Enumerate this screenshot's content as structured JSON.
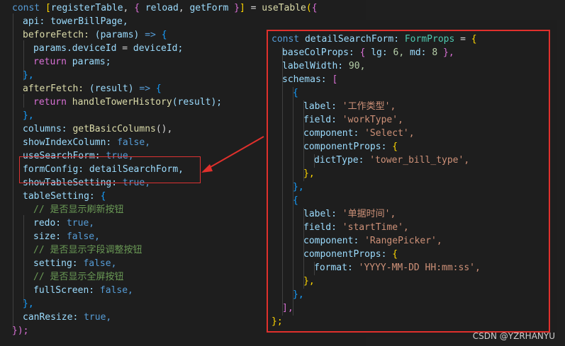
{
  "left_code": {
    "l1": {
      "a": "const",
      "b": "[",
      "c": "registerTable",
      ",": ",",
      "d": "{",
      "e": "reload",
      ",2": ",",
      "f": "getForm",
      "g": "}",
      "h": "]",
      "i": "=",
      "j": "useTable",
      "k": "(",
      "l": "{"
    },
    "l2": {
      "a": "api:",
      "b": "towerBillPage,"
    },
    "l3": {
      "a": "beforeFetch:",
      "b": "(params)",
      "c": "=>",
      "d": "{"
    },
    "l4": {
      "a": "params.deviceId",
      "b": "=",
      "c": "deviceId;"
    },
    "l5": {
      "a": "return",
      "b": "params;"
    },
    "l6": {
      "a": "},"
    },
    "l7": {
      "a": "afterFetch:",
      "b": "(result)",
      "c": "=>",
      "d": "{"
    },
    "l8": {
      "a": "return",
      "b": "handleTowerHistory",
      "c": "(result);"
    },
    "l9": {
      "a": "},"
    },
    "l10": {
      "a": "columns:",
      "b": "getBasicColumns",
      "c": "(),"
    },
    "l11": {
      "a": "showIndexColumn:",
      "b": "false,"
    },
    "l12": {
      "a": "useSearchForm:",
      "b": "true,"
    },
    "l13": {
      "a": "formConfig:",
      "b": "detailSearchForm,"
    },
    "l14": {
      "a": "showTableSetting:",
      "b": "true,"
    },
    "l15": {
      "a": "tableSetting:",
      "b": "{"
    },
    "l16": {
      "a": "// 是否显示刷新按钮"
    },
    "l17": {
      "a": "redo:",
      "b": "true,"
    },
    "l18": {
      "a": "size:",
      "b": "false,"
    },
    "l19": {
      "a": "// 是否显示字段调整按钮"
    },
    "l20": {
      "a": "setting:",
      "b": "false,"
    },
    "l21": {
      "a": "// 是否显示全屏按钮"
    },
    "l22": {
      "a": "fullScreen:",
      "b": "false,"
    },
    "l23": {
      "a": "},"
    },
    "l24": {
      "a": "canResize:",
      "b": "true,"
    },
    "l25": {
      "a": "});"
    }
  },
  "right_code": {
    "r1": {
      "a": "const",
      "b": "detailSearchForm:",
      "c": "FormProps",
      "d": "=",
      "e": "{"
    },
    "r2": {
      "a": "baseColProps:",
      "b": "{",
      "c": "lg:",
      "d": "6,",
      "e": "md:",
      "f": "8",
      "g": "},"
    },
    "r3": {
      "a": "labelWidth:",
      "b": "90,"
    },
    "r4": {
      "a": "schemas:",
      "b": "["
    },
    "r5": {
      "a": "{"
    },
    "r6": {
      "a": "label:",
      "b": "'工作类型',"
    },
    "r7": {
      "a": "field:",
      "b": "'workType',"
    },
    "r8": {
      "a": "component:",
      "b": "'Select',"
    },
    "r9": {
      "a": "componentProps:",
      "b": "{"
    },
    "r10": {
      "a": "dictType:",
      "b": "'tower_bill_type',"
    },
    "r11": {
      "a": "},"
    },
    "r12": {
      "a": "},"
    },
    "r13": {
      "a": "{"
    },
    "r14": {
      "a": "label:",
      "b": "'单据时间',"
    },
    "r15": {
      "a": "field:",
      "b": "'startTime',"
    },
    "r16": {
      "a": "component:",
      "b": "'RangePicker',"
    },
    "r17": {
      "a": "componentProps:",
      "b": "{"
    },
    "r18": {
      "a": "format:",
      "b": "'YYYY-MM-DD HH:mm:ss',"
    },
    "r19": {
      "a": "},"
    },
    "r20": {
      "a": "},"
    },
    "r21": {
      "a": "],"
    },
    "r22": {
      "a": "};"
    }
  },
  "watermark": "CSDN @YZRHANYU",
  "colors": {
    "highlight_box": "#e0302c",
    "arrow": "#e0302c",
    "background": "#1e1e1e"
  }
}
